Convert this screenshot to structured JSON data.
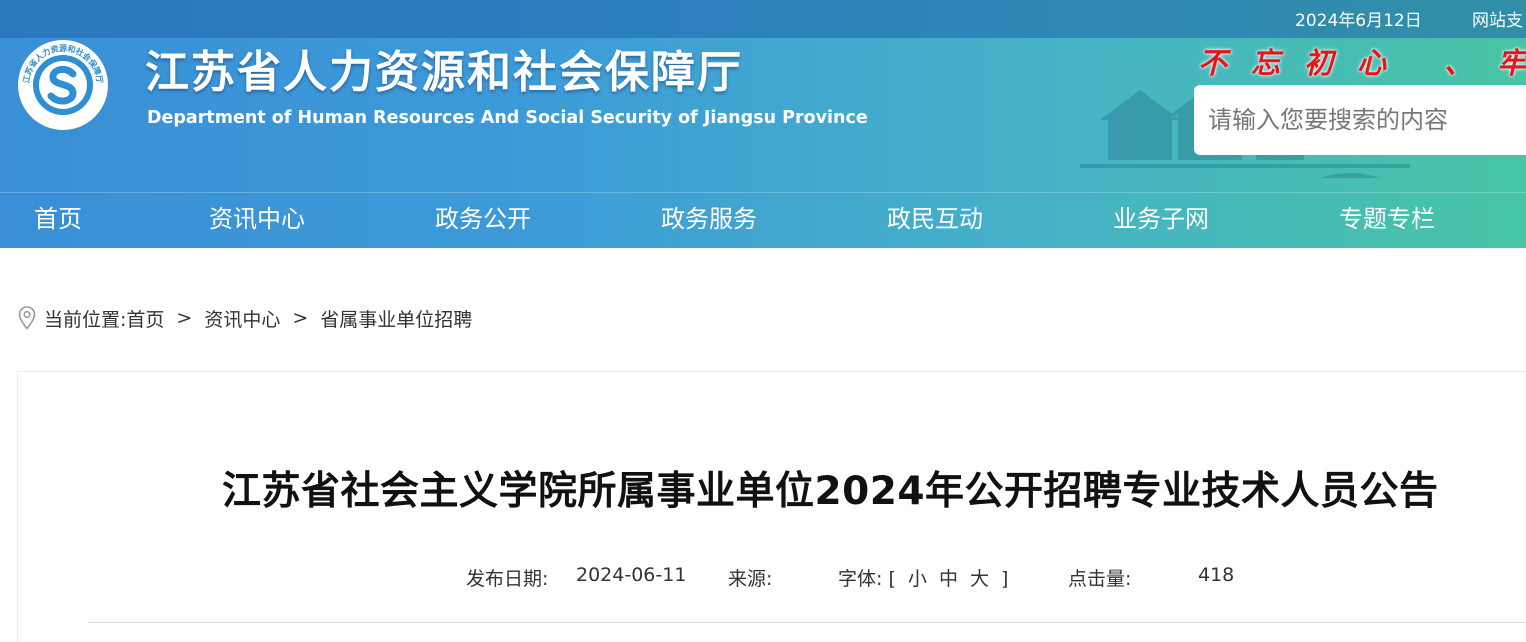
{
  "header": {
    "date": "2024年6月12日",
    "site_link": "网站支",
    "title": "江苏省人力资源和社会保障厅",
    "subtitle": "Department of Human Resources And Social Security of Jiangsu Province",
    "logo_text": "江苏省人力资源和社会保障厅",
    "slogan": "不忘初心 、牢",
    "search_placeholder": "请输入您要搜索的内容"
  },
  "nav": {
    "items": [
      "首页",
      "资讯中心",
      "政务公开",
      "政务服务",
      "政民互动",
      "业务子网",
      "专题专栏"
    ]
  },
  "breadcrumb": {
    "prefix": "当前位置:",
    "items": [
      "首页",
      "资讯中心",
      "省属事业单位招聘"
    ],
    "separator": ">"
  },
  "article": {
    "title": "江苏省社会主义学院所属事业单位2024年公开招聘专业技术人员公告",
    "meta": {
      "date_label": "发布日期:",
      "date_value": "2024-06-11",
      "source_label": "来源:",
      "source_value": "",
      "font_label": "字体:",
      "font_open": "[",
      "font_small": "小",
      "font_medium": "中",
      "font_large": "大",
      "font_close": "]",
      "views_label": "点击量:",
      "views_value": "418"
    }
  },
  "colors": {
    "header_blue": "#3a8fd6",
    "header_green": "#47c4a4",
    "slogan_red": "#e8141a"
  },
  "icons": {
    "logo": "emblem-logo",
    "breadcrumb": "location-pin-icon"
  }
}
